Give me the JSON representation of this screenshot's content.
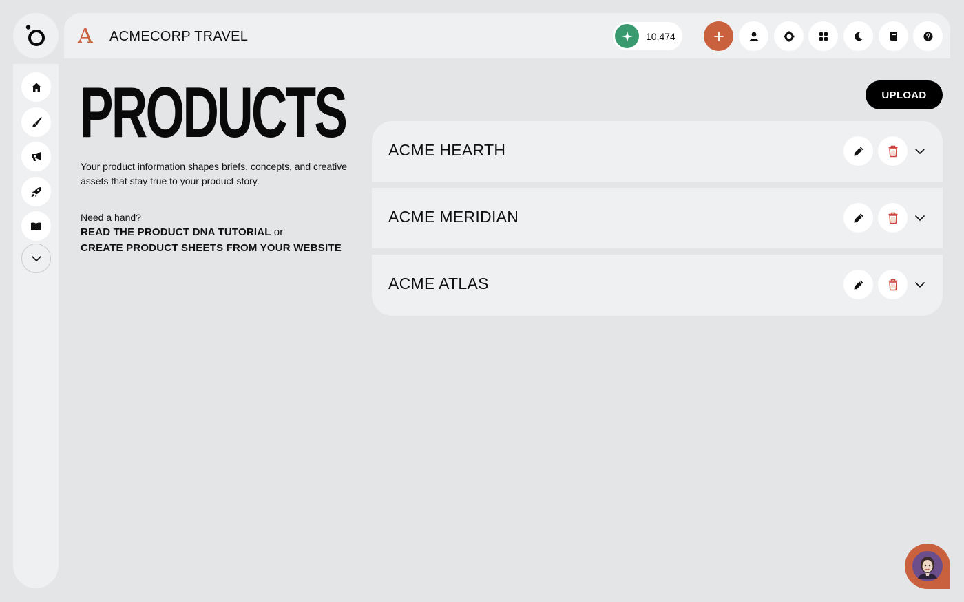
{
  "brand": {
    "logo_letter": "A",
    "name": "ACMECORP TRAVEL",
    "accent": "#c9613f"
  },
  "header": {
    "credits_value": "10,474",
    "credits_color": "#3a9a6f",
    "buttons": [
      "plus-icon",
      "user-icon",
      "gear-icon",
      "grid-icon",
      "moon-icon",
      "book-icon",
      "help-icon"
    ]
  },
  "sidebar": {
    "items": [
      "home-icon",
      "brush-icon",
      "megaphone-icon",
      "rocket-icon",
      "open-book-icon"
    ],
    "more": "chevron-down-icon"
  },
  "main": {
    "title": "PRODUCTS",
    "description": "Your product information shapes briefs, concepts, and creative assets that stay true to your product story.",
    "help_intro": "Need a hand?",
    "help_link_tutorial": "READ THE PRODUCT DNA TUTORIAL",
    "help_or": "or",
    "help_link_sheets": "CREATE PRODUCT SHEETS FROM YOUR WEBSITE",
    "upload_label": "UPLOAD"
  },
  "products": [
    {
      "name": "ACME HEARTH"
    },
    {
      "name": "ACME MERIDIAN"
    },
    {
      "name": "ACME ATLAS"
    }
  ],
  "colors": {
    "delete": "#d0463f",
    "background": "#e4e5e7",
    "panel": "#eef0f2"
  }
}
